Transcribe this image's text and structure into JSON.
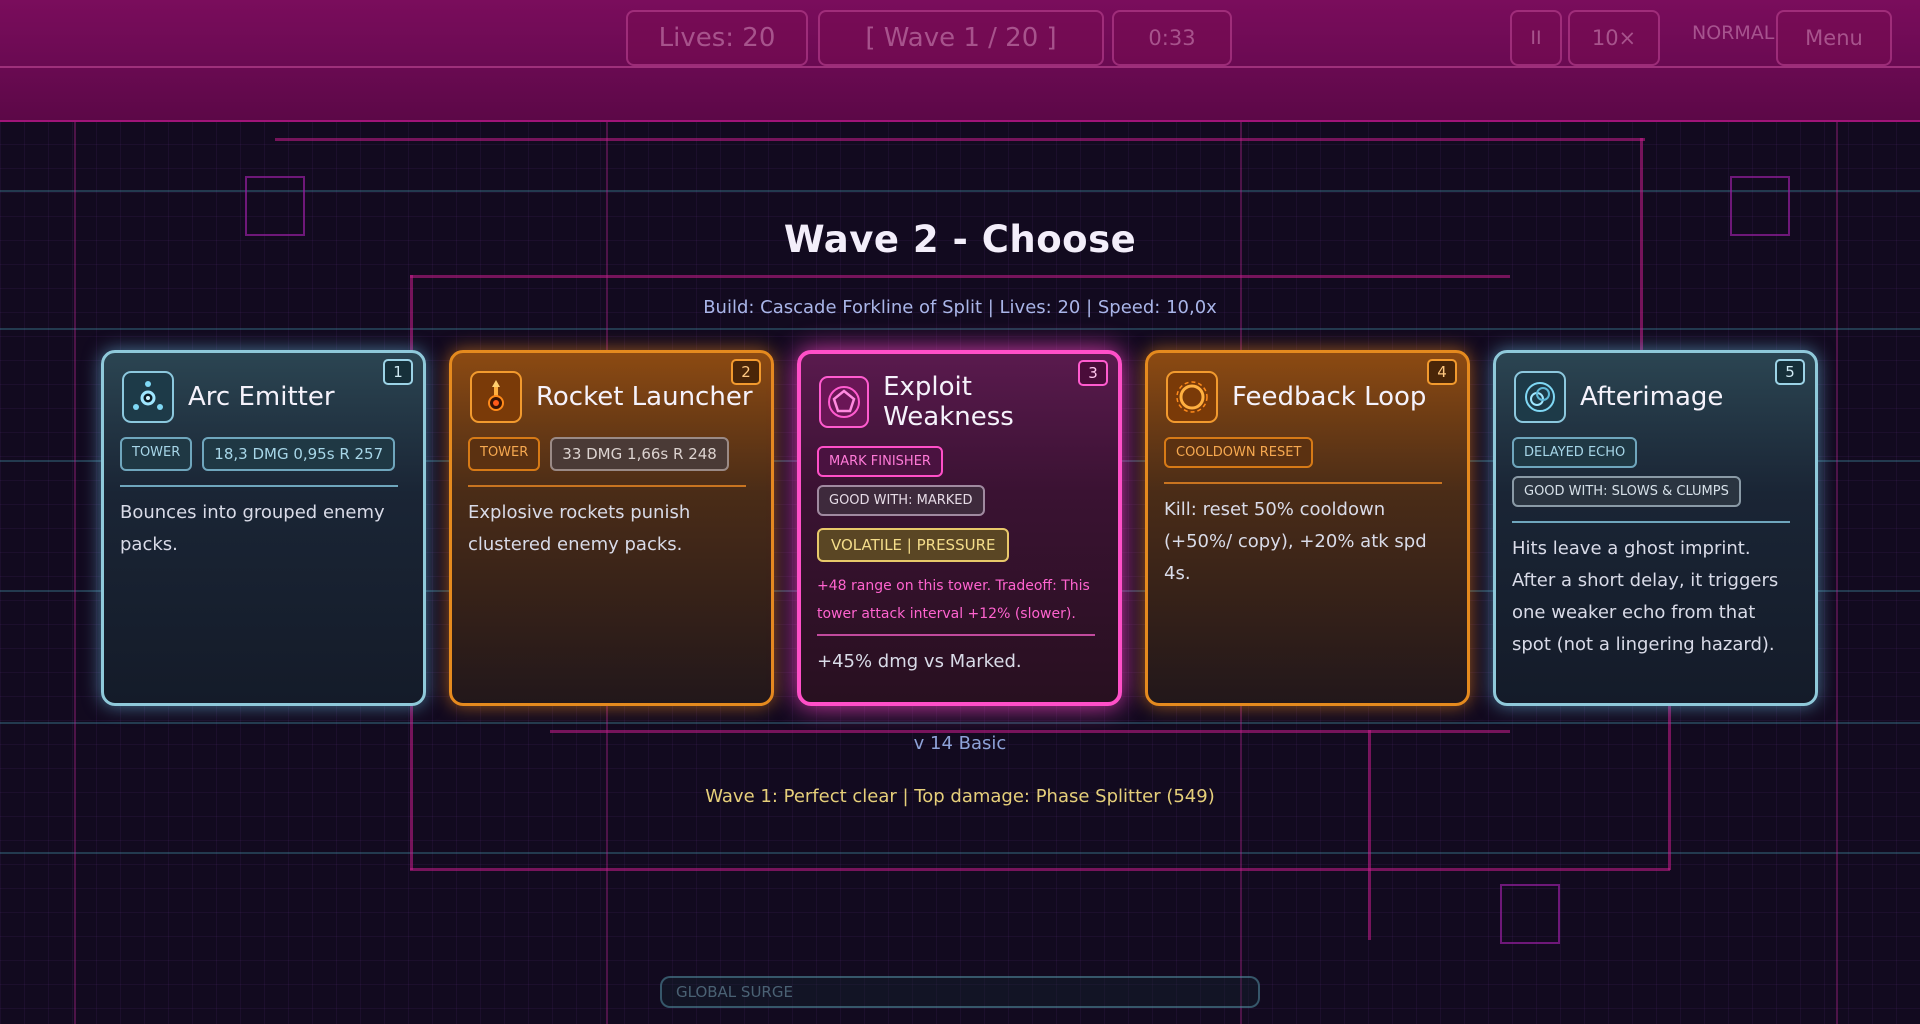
{
  "hud": {
    "lives": "Lives: 20",
    "wave": "[ Wave 1 / 20 ]",
    "timer": "0:33",
    "pause": "II",
    "speed": "10×",
    "difficulty": "NORMAL",
    "menu": "Menu"
  },
  "title": "Wave 2  -  Choose",
  "build_info": "Build: Cascade Forkline of Split  |  Lives: 20  |  Speed: 10,0x",
  "cards": [
    {
      "number": "1",
      "title": "Arc Emitter",
      "icon": "arc-emitter-icon",
      "tags": [
        "TOWER",
        "18,3 DMG   0,95s   R 257"
      ],
      "description": "Bounces into grouped enemy packs."
    },
    {
      "number": "2",
      "title": "Rocket Launcher",
      "icon": "rocket-icon",
      "tags": [
        "TOWER",
        "33 DMG   1,66s   R 248"
      ],
      "description": "Explosive rockets punish clustered enemy packs."
    },
    {
      "number": "3",
      "title": "Exploit Weakness",
      "icon": "pentagon-icon",
      "tags": [
        "MARK FINISHER",
        "GOOD WITH: MARKED",
        "VOLATILE | PRESSURE"
      ],
      "note": "+48 range on this tower. Tradeoff: This tower attack interval +12% (slower).",
      "description": "+45% dmg vs Marked."
    },
    {
      "number": "4",
      "title": "Feedback Loop",
      "icon": "loop-icon",
      "tags": [
        "COOLDOWN RESET"
      ],
      "description": "Kill: reset 50% cooldown (+50%/ copy), +20% atk spd 4s."
    },
    {
      "number": "5",
      "title": "Afterimage",
      "icon": "echo-icon",
      "tags": [
        "DELAYED ECHO",
        "GOOD WITH: SLOWS & CLUMPS"
      ],
      "description": "Hits leave a ghost imprint. After a short delay, it triggers one weaker echo from that spot (not a lingering hazard)."
    }
  ],
  "basic_line": "v  14 Basic",
  "result_line": "Wave 1: Perfect clear   |   Top damage: Phase Splitter (549)",
  "surge_label": "GLOBAL SURGE",
  "colors": {
    "blue_accent": "#8fc9da",
    "orange_accent": "#e58a1e",
    "pink_accent": "#ff4fc8",
    "hud_bg": "#7a0d5c"
  }
}
